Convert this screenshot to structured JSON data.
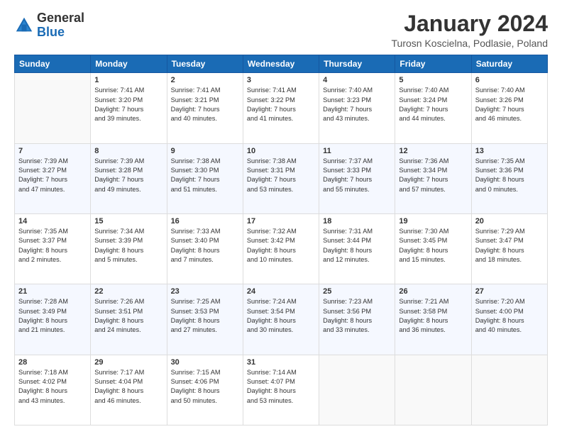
{
  "header": {
    "logo_general": "General",
    "logo_blue": "Blue",
    "title": "January 2024",
    "location": "Turosn Koscielna, Podlasie, Poland"
  },
  "days_of_week": [
    "Sunday",
    "Monday",
    "Tuesday",
    "Wednesday",
    "Thursday",
    "Friday",
    "Saturday"
  ],
  "weeks": [
    [
      {
        "day": "",
        "info": ""
      },
      {
        "day": "1",
        "info": "Sunrise: 7:41 AM\nSunset: 3:20 PM\nDaylight: 7 hours\nand 39 minutes."
      },
      {
        "day": "2",
        "info": "Sunrise: 7:41 AM\nSunset: 3:21 PM\nDaylight: 7 hours\nand 40 minutes."
      },
      {
        "day": "3",
        "info": "Sunrise: 7:41 AM\nSunset: 3:22 PM\nDaylight: 7 hours\nand 41 minutes."
      },
      {
        "day": "4",
        "info": "Sunrise: 7:40 AM\nSunset: 3:23 PM\nDaylight: 7 hours\nand 43 minutes."
      },
      {
        "day": "5",
        "info": "Sunrise: 7:40 AM\nSunset: 3:24 PM\nDaylight: 7 hours\nand 44 minutes."
      },
      {
        "day": "6",
        "info": "Sunrise: 7:40 AM\nSunset: 3:26 PM\nDaylight: 7 hours\nand 46 minutes."
      }
    ],
    [
      {
        "day": "7",
        "info": "Sunrise: 7:39 AM\nSunset: 3:27 PM\nDaylight: 7 hours\nand 47 minutes."
      },
      {
        "day": "8",
        "info": "Sunrise: 7:39 AM\nSunset: 3:28 PM\nDaylight: 7 hours\nand 49 minutes."
      },
      {
        "day": "9",
        "info": "Sunrise: 7:38 AM\nSunset: 3:30 PM\nDaylight: 7 hours\nand 51 minutes."
      },
      {
        "day": "10",
        "info": "Sunrise: 7:38 AM\nSunset: 3:31 PM\nDaylight: 7 hours\nand 53 minutes."
      },
      {
        "day": "11",
        "info": "Sunrise: 7:37 AM\nSunset: 3:33 PM\nDaylight: 7 hours\nand 55 minutes."
      },
      {
        "day": "12",
        "info": "Sunrise: 7:36 AM\nSunset: 3:34 PM\nDaylight: 7 hours\nand 57 minutes."
      },
      {
        "day": "13",
        "info": "Sunrise: 7:35 AM\nSunset: 3:36 PM\nDaylight: 8 hours\nand 0 minutes."
      }
    ],
    [
      {
        "day": "14",
        "info": "Sunrise: 7:35 AM\nSunset: 3:37 PM\nDaylight: 8 hours\nand 2 minutes."
      },
      {
        "day": "15",
        "info": "Sunrise: 7:34 AM\nSunset: 3:39 PM\nDaylight: 8 hours\nand 5 minutes."
      },
      {
        "day": "16",
        "info": "Sunrise: 7:33 AM\nSunset: 3:40 PM\nDaylight: 8 hours\nand 7 minutes."
      },
      {
        "day": "17",
        "info": "Sunrise: 7:32 AM\nSunset: 3:42 PM\nDaylight: 8 hours\nand 10 minutes."
      },
      {
        "day": "18",
        "info": "Sunrise: 7:31 AM\nSunset: 3:44 PM\nDaylight: 8 hours\nand 12 minutes."
      },
      {
        "day": "19",
        "info": "Sunrise: 7:30 AM\nSunset: 3:45 PM\nDaylight: 8 hours\nand 15 minutes."
      },
      {
        "day": "20",
        "info": "Sunrise: 7:29 AM\nSunset: 3:47 PM\nDaylight: 8 hours\nand 18 minutes."
      }
    ],
    [
      {
        "day": "21",
        "info": "Sunrise: 7:28 AM\nSunset: 3:49 PM\nDaylight: 8 hours\nand 21 minutes."
      },
      {
        "day": "22",
        "info": "Sunrise: 7:26 AM\nSunset: 3:51 PM\nDaylight: 8 hours\nand 24 minutes."
      },
      {
        "day": "23",
        "info": "Sunrise: 7:25 AM\nSunset: 3:53 PM\nDaylight: 8 hours\nand 27 minutes."
      },
      {
        "day": "24",
        "info": "Sunrise: 7:24 AM\nSunset: 3:54 PM\nDaylight: 8 hours\nand 30 minutes."
      },
      {
        "day": "25",
        "info": "Sunrise: 7:23 AM\nSunset: 3:56 PM\nDaylight: 8 hours\nand 33 minutes."
      },
      {
        "day": "26",
        "info": "Sunrise: 7:21 AM\nSunset: 3:58 PM\nDaylight: 8 hours\nand 36 minutes."
      },
      {
        "day": "27",
        "info": "Sunrise: 7:20 AM\nSunset: 4:00 PM\nDaylight: 8 hours\nand 40 minutes."
      }
    ],
    [
      {
        "day": "28",
        "info": "Sunrise: 7:18 AM\nSunset: 4:02 PM\nDaylight: 8 hours\nand 43 minutes."
      },
      {
        "day": "29",
        "info": "Sunrise: 7:17 AM\nSunset: 4:04 PM\nDaylight: 8 hours\nand 46 minutes."
      },
      {
        "day": "30",
        "info": "Sunrise: 7:15 AM\nSunset: 4:06 PM\nDaylight: 8 hours\nand 50 minutes."
      },
      {
        "day": "31",
        "info": "Sunrise: 7:14 AM\nSunset: 4:07 PM\nDaylight: 8 hours\nand 53 minutes."
      },
      {
        "day": "",
        "info": ""
      },
      {
        "day": "",
        "info": ""
      },
      {
        "day": "",
        "info": ""
      }
    ]
  ]
}
